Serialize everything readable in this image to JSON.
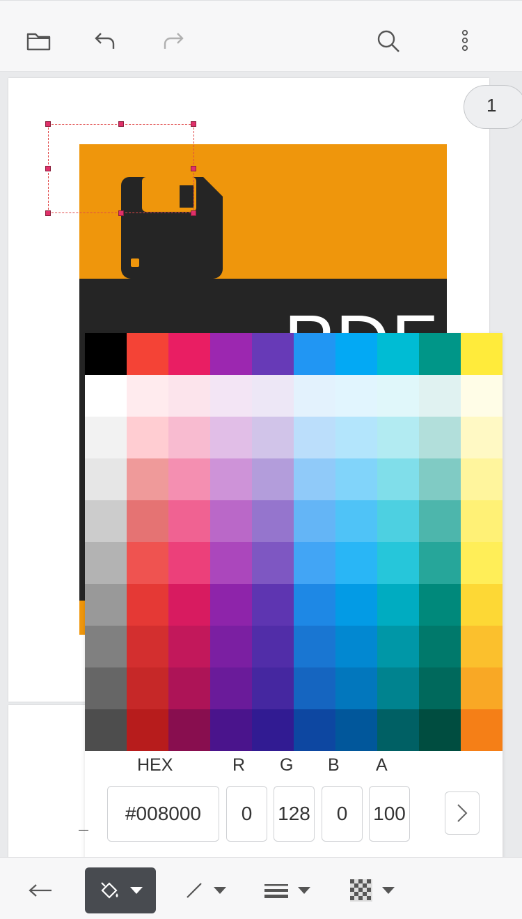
{
  "toolbar": {
    "open_icon": "folder-icon",
    "undo_icon": "undo-icon",
    "redo_icon": "redo-icon",
    "search_icon": "search-icon",
    "menu_icon": "more-vertical-icon"
  },
  "document": {
    "page_number": "1",
    "art_text": "PDF",
    "colors": {
      "orange": "#ef960c",
      "dark": "#252525"
    }
  },
  "color_picker": {
    "swatches": [
      [
        "#000000",
        "#f44336",
        "#e91e63",
        "#9c27b0",
        "#673ab7",
        "#2196f3",
        "#03a9f4",
        "#00bcd4",
        "#009688",
        "#ffeb3b"
      ],
      [
        "#ffffff",
        "#ffebee",
        "#fce4ec",
        "#f3e5f5",
        "#ede7f6",
        "#e3f2fd",
        "#e1f5fe",
        "#e0f7fa",
        "#e0f2f1",
        "#fffde7"
      ],
      [
        "#f2f2f2",
        "#ffcdd2",
        "#f8bbd0",
        "#e1bee7",
        "#d1c4e9",
        "#bbdefb",
        "#b3e5fc",
        "#b2ebf2",
        "#b2dfdb",
        "#fff9c4"
      ],
      [
        "#e6e6e6",
        "#ef9a9a",
        "#f48fb1",
        "#ce93d8",
        "#b39ddb",
        "#90caf9",
        "#81d4fa",
        "#80deea",
        "#80cbc4",
        "#fff59d"
      ],
      [
        "#cccccc",
        "#e57373",
        "#f06292",
        "#ba68c8",
        "#9575cd",
        "#64b5f6",
        "#4fc3f7",
        "#4dd0e1",
        "#4db6ac",
        "#fff176"
      ],
      [
        "#b3b3b3",
        "#ef5350",
        "#ec407a",
        "#ab47bc",
        "#7e57c2",
        "#42a5f5",
        "#29b6f6",
        "#26c6da",
        "#26a69a",
        "#ffee58"
      ],
      [
        "#999999",
        "#e53935",
        "#d81b60",
        "#8e24aa",
        "#5e35b1",
        "#1e88e5",
        "#039be5",
        "#00acc1",
        "#00897b",
        "#fdd835"
      ],
      [
        "#808080",
        "#d32f2f",
        "#c2185b",
        "#7b1fa2",
        "#512da8",
        "#1976d2",
        "#0288d1",
        "#0097a7",
        "#00796b",
        "#fbc02d"
      ],
      [
        "#666666",
        "#c62828",
        "#ad1457",
        "#6a1b9a",
        "#4527a0",
        "#1565c0",
        "#0277bd",
        "#00838f",
        "#00695c",
        "#f9a825"
      ],
      [
        "#4d4d4d",
        "#b71c1c",
        "#880e4f",
        "#4a148c",
        "#311b92",
        "#0d47a1",
        "#01579b",
        "#006064",
        "#004d40",
        "#f57f17"
      ]
    ],
    "labels": {
      "hex": "HEX",
      "r": "R",
      "g": "G",
      "b": "B",
      "a": "A"
    },
    "values": {
      "hex": "#008000",
      "r": "0",
      "g": "128",
      "b": "0",
      "a": "100"
    }
  },
  "bottom_toolbar": {
    "back_icon": "arrow-left-icon",
    "fill_icon": "paint-bucket-icon",
    "line_icon": "line-icon",
    "stroke_width_icon": "line-width-icon",
    "opacity_icon": "checkerboard-icon"
  }
}
